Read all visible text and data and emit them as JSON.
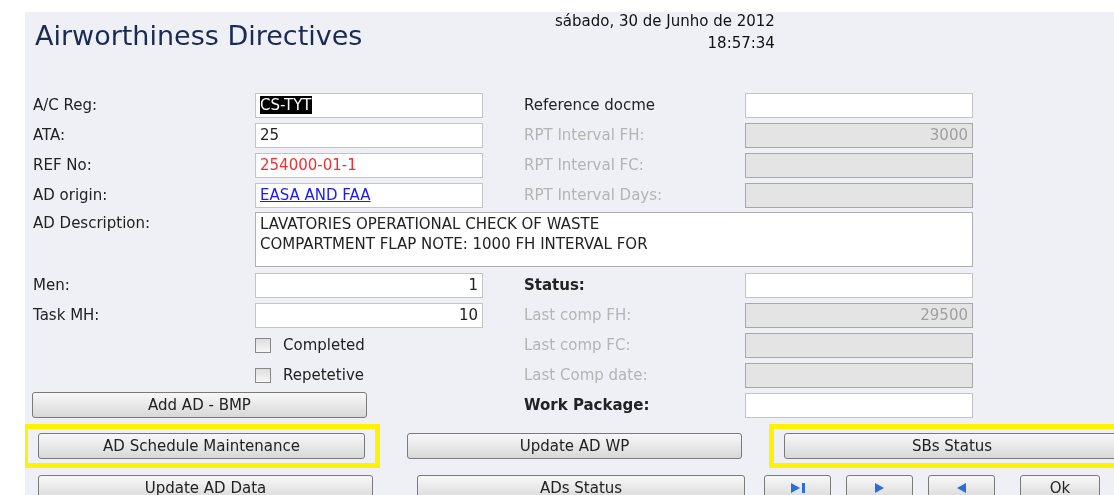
{
  "title": "Airworthiness Directives",
  "date": "sábado, 30 de Junho de 2012",
  "time": "18:57:34",
  "left_fields": [
    {
      "label": "A/C Reg:",
      "value": "CS-TYT",
      "kind": "selected-text",
      "disabled": false
    },
    {
      "label": "ATA:",
      "value": "25",
      "kind": "text",
      "disabled": false
    },
    {
      "label": "REF No:",
      "value": "254000-01-1",
      "kind": "warning",
      "disabled": false
    },
    {
      "label": "AD origin:",
      "value": "EASA AND FAA",
      "kind": "link",
      "disabled": false
    }
  ],
  "right_fields": [
    {
      "label": "Reference docme",
      "kind": "text",
      "disabled": false
    },
    {
      "label": "RPT Interval FH:",
      "value": "3000",
      "kind": "number",
      "disabled": true
    },
    {
      "label": "RPT Interval FC:",
      "kind": "number",
      "disabled": true
    },
    {
      "label": "RPT Interval Days:",
      "kind": "number",
      "disabled": true
    }
  ],
  "description": {
    "label": "AD Description:",
    "lines": [
      "LAVATORIES OPERATIONAL CHECK OF WASTE",
      "COMPARTMENT FLAP NOTE: 1000 FH INTERVAL FOR"
    ]
  },
  "left_fields_2": [
    {
      "label": "Men:",
      "value": "1",
      "kind": "number",
      "disabled": false
    },
    {
      "label": "Task MH:",
      "value": "10",
      "kind": "number",
      "disabled": false
    }
  ],
  "checkboxes": [
    {
      "label": "Completed",
      "checked": false
    },
    {
      "label": "Repetetive",
      "checked": false
    }
  ],
  "right_fields_2": [
    {
      "label": "Status:",
      "kind": "text",
      "disabled": false
    },
    {
      "label": "Last comp FH:",
      "value": "29500",
      "kind": "number",
      "disabled": true
    },
    {
      "label": "Last comp FC:",
      "kind": "number",
      "disabled": true
    },
    {
      "label": "Last Comp date:",
      "kind": "number",
      "disabled": true
    },
    {
      "label": "Work Package:",
      "kind": "text",
      "disabled": false
    }
  ],
  "add_button": {
    "label": "Add AD - BMP",
    "highlighted": false
  },
  "button_row_1": [
    {
      "label": "AD Schedule Maintenance",
      "highlighted": true
    },
    {
      "label": "Update AD WP",
      "highlighted": false
    },
    {
      "label": "SBs Status",
      "highlighted": true
    }
  ],
  "button_row_2": [
    {
      "label": "Update AD Data",
      "highlighted": false
    },
    {
      "label": "ADs Status",
      "highlighted": false
    }
  ],
  "nav_buttons": [
    {
      "kind": "last"
    },
    {
      "kind": "next"
    },
    {
      "kind": "previous"
    },
    {
      "kind": "text",
      "label": "Ok"
    }
  ]
}
